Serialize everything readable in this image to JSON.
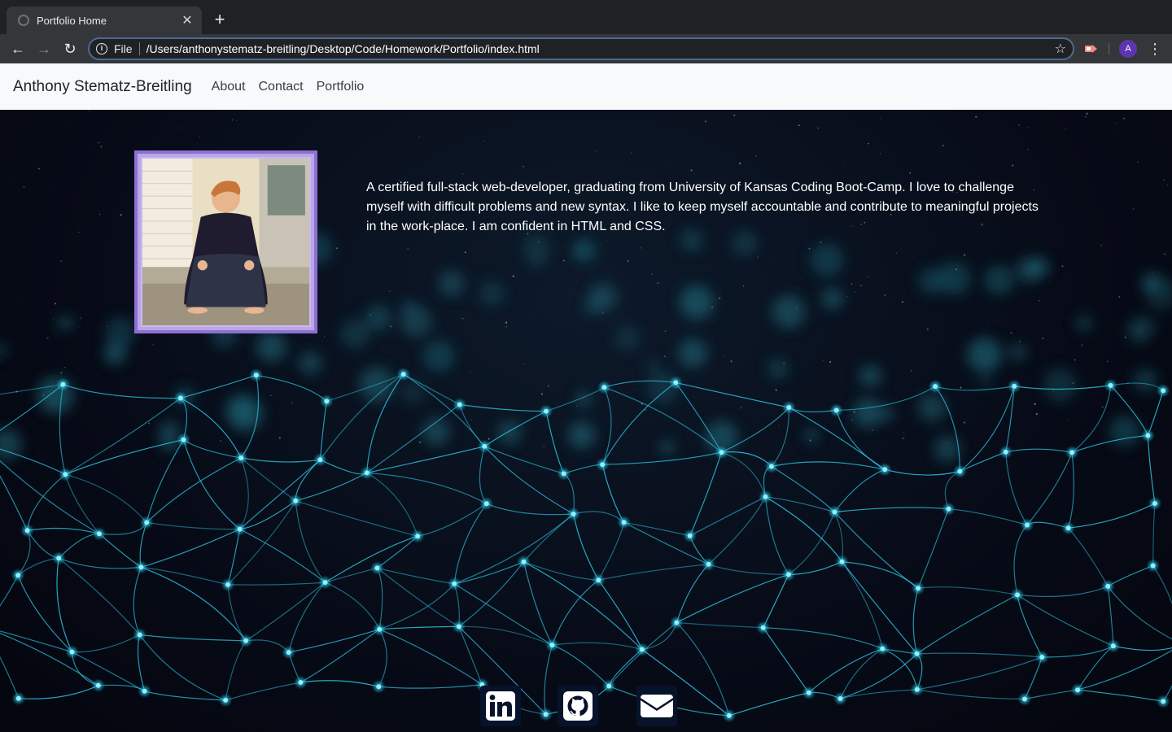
{
  "browser": {
    "tab_title": "Portfolio Home",
    "new_tab_label": "+",
    "scheme_label": "File",
    "url": "/Users/anthonystematz-breitling/Desktop/Code/Homework/Portfolio/index.html",
    "profile_initial": "A"
  },
  "navbar": {
    "brand": "Anthony Stematz-Breitling",
    "links": [
      "About",
      "Contact",
      "Portfolio"
    ]
  },
  "main": {
    "bio": "A certified full-stack web-developer, graduating from University of Kansas Coding Boot-Camp. I love to challenge myself with difficult problems and new syntax. I like to keep myself accountable and contribute to meaningful projects in the work-place. I am confident in HTML and CSS."
  },
  "social": {
    "icons": [
      "linkedin-icon",
      "github-icon",
      "email-icon"
    ]
  },
  "colors": {
    "frame_accent": "#8f6fd3",
    "network_glow": "#2ec8e6",
    "navbar_bg": "#f8f9fa",
    "hero_bg": "#070b17"
  }
}
